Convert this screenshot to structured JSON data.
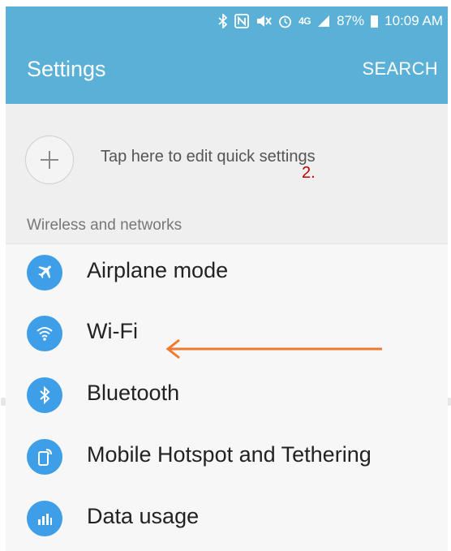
{
  "status_bar": {
    "battery": "87%",
    "time": "10:09 AM",
    "icons": [
      "bluetooth-icon",
      "nfc-icon",
      "mute-icon",
      "alarm-icon",
      "lte-icon",
      "signal-icon",
      "battery-icon"
    ],
    "lte_label": "4G"
  },
  "header": {
    "title": "Settings",
    "search_label": "SEARCH"
  },
  "quick_settings": {
    "text": "Tap here to edit quick settings"
  },
  "annotation": {
    "text": "2."
  },
  "section": {
    "title": "Wireless and networks"
  },
  "items": [
    {
      "label": "Airplane mode",
      "icon": "airplane-icon"
    },
    {
      "label": "Wi-Fi",
      "icon": "wifi-icon"
    },
    {
      "label": "Bluetooth",
      "icon": "bluetooth-icon"
    },
    {
      "label": "Mobile Hotspot and Tethering",
      "icon": "hotspot-icon"
    },
    {
      "label": "Data usage",
      "icon": "data-usage-icon"
    }
  ],
  "colors": {
    "header": "#5ab0d6",
    "icon_bg": "#3f9ee8",
    "arrow": "#ee7a2f",
    "annotation": "#c00000"
  }
}
